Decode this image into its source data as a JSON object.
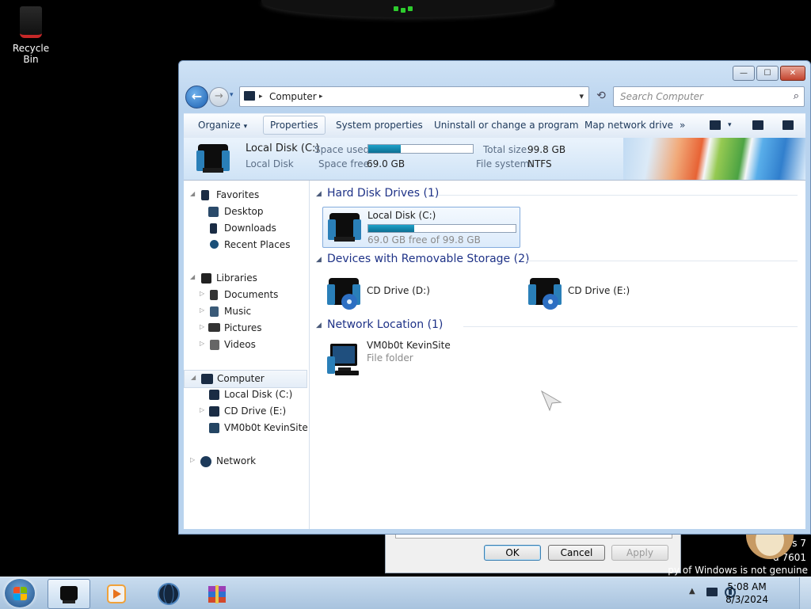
{
  "desktop": {
    "recycle_bin_label": "Recycle Bin",
    "watermark": {
      "line1": "vs 7",
      "line2": "d 7601",
      "line3": "py of Windows is not genuine"
    }
  },
  "background_dialog": {
    "ok": "OK",
    "cancel": "Cancel",
    "apply": "Apply"
  },
  "window": {
    "caption_buttons": {
      "minimize": "—",
      "maximize": "☐",
      "close": "✕"
    },
    "nav": {
      "back_glyph": "←",
      "forward_glyph": "→",
      "history_glyph": "▾",
      "address_segment": "Computer",
      "address_chevron": "▸",
      "address_dropdown_glyph": "▾",
      "refresh_glyph": "⟲",
      "search_placeholder": "Search Computer",
      "search_glyph": "⌕"
    },
    "command_bar": {
      "organize": "Organize",
      "organize_arrow": "▾",
      "properties": "Properties",
      "system_properties": "System properties",
      "uninstall": "Uninstall or change a program",
      "map_drive": "Map network drive",
      "more": "»",
      "views_arrow": "▾"
    },
    "details_bar": {
      "name": "Local Disk (C:)",
      "type": "Local Disk",
      "space_used_label": "Space used:",
      "space_free_label": "Space free:",
      "space_free_value": "69.0 GB",
      "total_size_label": "Total size:",
      "total_size_value": "99.8 GB",
      "file_system_label": "File system:",
      "file_system_value": "NTFS",
      "used_fraction": 0.31
    },
    "nav_pane": {
      "favorites": "Favorites",
      "desktop": "Desktop",
      "downloads": "Downloads",
      "recent_places": "Recent Places",
      "libraries": "Libraries",
      "documents": "Documents",
      "music": "Music",
      "pictures": "Pictures",
      "videos": "Videos",
      "computer": "Computer",
      "local_disk": "Local Disk (C:)",
      "cd_drive_e": "CD Drive (E:)",
      "network_site": "VM0b0t KevinSite",
      "network": "Network",
      "expanded_glyph": "◢",
      "collapsed_glyph": "▷"
    },
    "content": {
      "hdd_group": "Hard Disk Drives (1)",
      "removable_group": "Devices with Removable Storage (2)",
      "network_group": "Network Location (1)",
      "local_disk": {
        "name": "Local Disk (C:)",
        "free_text": "69.0 GB free of 99.8 GB",
        "used_fraction": 0.31
      },
      "cd_d": "CD Drive (D:)",
      "cd_e": "CD Drive (E:)",
      "net": {
        "name": "VM0b0t KevinSite",
        "type": "File folder"
      }
    }
  },
  "taskbar": {
    "tray_arrow": "▲",
    "time": "5:08 AM",
    "date": "8/3/2024"
  }
}
